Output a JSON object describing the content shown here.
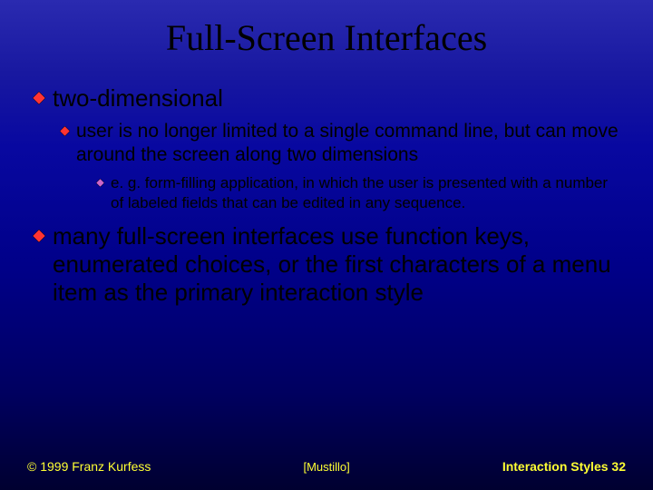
{
  "title": "Full-Screen Interfaces",
  "bullets": {
    "l1a": "two-dimensional",
    "l2a": "user is no longer limited to a single command line, but can move around the screen along two dimensions",
    "l3a": "e. g. form-filling application, in which the user is presented with a number of labeled fields that can be edited in any sequence.",
    "l1b": "many full-screen interfaces use function keys, enumerated choices, or the first characters of a menu item as the primary interaction style"
  },
  "footer": {
    "left": "© 1999 Franz Kurfess",
    "center": "[Mustillo]",
    "right": "Interaction Styles  32"
  },
  "colors": {
    "bullet_fill": "#ff3333",
    "bullet_stroke": "#000000",
    "sub_bullet_fill": "#cc66cc"
  }
}
